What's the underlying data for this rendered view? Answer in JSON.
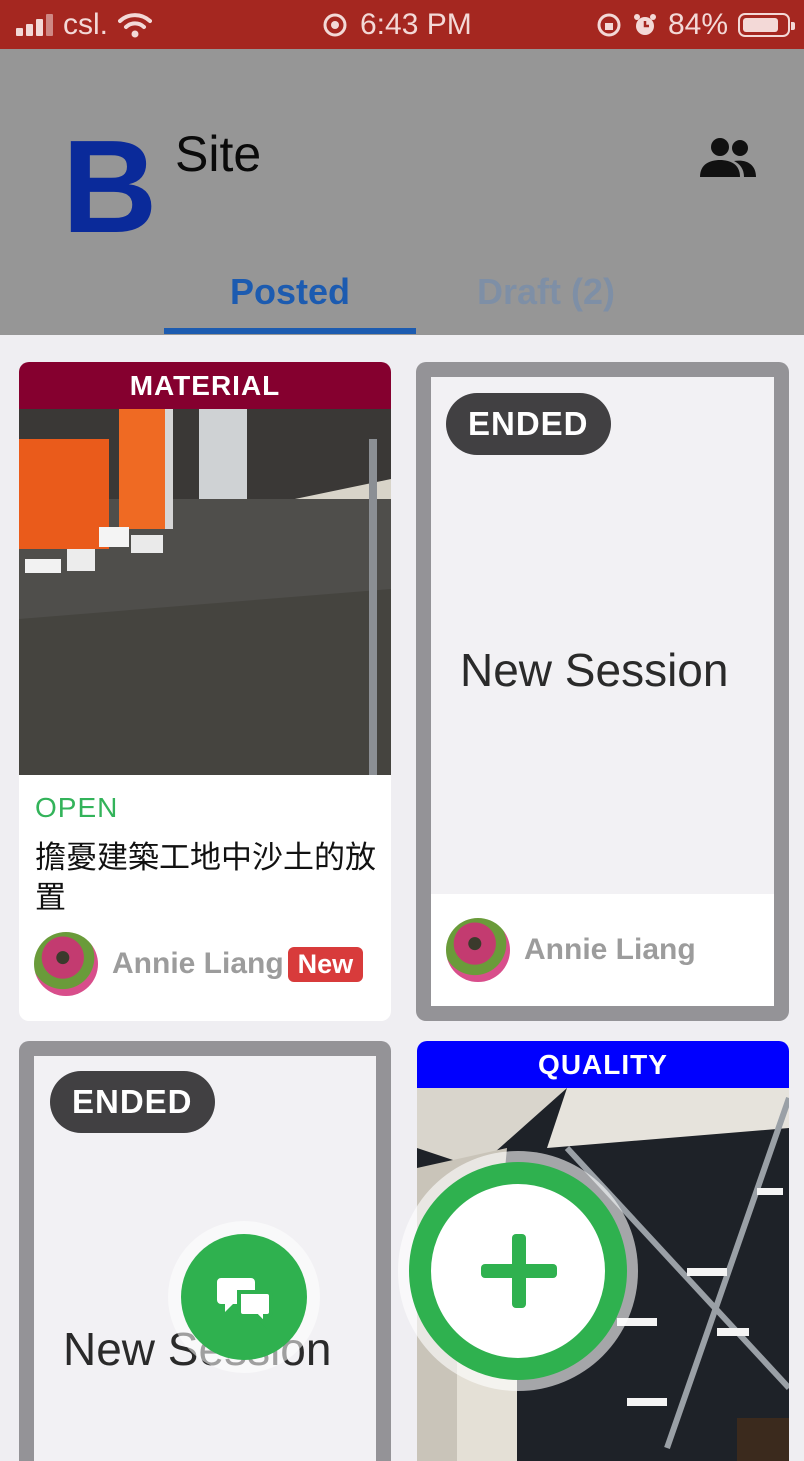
{
  "status_bar": {
    "carrier": "csl.",
    "time": "6:43 PM",
    "battery_percent": "84%",
    "battery_level": 0.84
  },
  "header": {
    "logo_letter": "B",
    "title": "Site",
    "tabs": [
      {
        "label": "Posted",
        "active": true
      },
      {
        "label": "Draft (2)",
        "active": false
      }
    ]
  },
  "cards": [
    {
      "category": "MATERIAL",
      "category_color": "#85002f",
      "status": "OPEN",
      "title": "擔憂建築工地中沙土的放置",
      "author": "Annie Liang",
      "badge": "New"
    },
    {
      "status": "ENDED",
      "title": "New Session",
      "author": "Annie Liang"
    },
    {
      "status": "ENDED",
      "title": "New Session"
    },
    {
      "category": "QUALITY",
      "category_color": "#0000ff"
    }
  ],
  "colors": {
    "status_bar": "#a52720",
    "header_bg": "#969696",
    "accent_blue": "#1c5bb0",
    "open_green": "#33b35a",
    "fab_green": "#2fb14f",
    "ended_pill": "#414042",
    "new_badge": "#d83b3b"
  },
  "icons": {
    "people": "people-icon",
    "chat": "chat-bubbles-icon",
    "add": "plus-icon"
  }
}
